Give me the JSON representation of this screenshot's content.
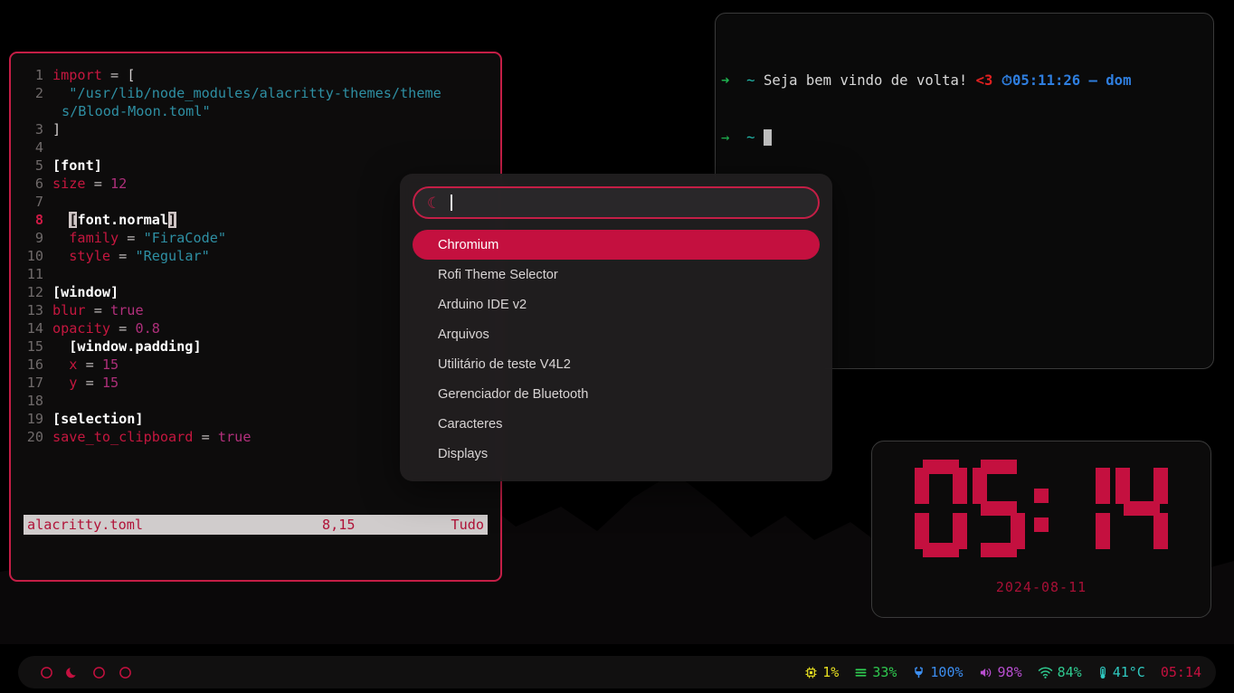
{
  "desktop": {
    "wallpaper_color": "#000000",
    "accent_color": "#c4103f"
  },
  "editor": {
    "window_name": "alacritty-editor",
    "border_color": "#c41e46",
    "lines": [
      {
        "n": "1",
        "current": false
      },
      {
        "n": "2",
        "current": false
      },
      {
        "n": "3",
        "current": false
      },
      {
        "n": "4",
        "current": false
      },
      {
        "n": "5",
        "current": false
      },
      {
        "n": "6",
        "current": false
      },
      {
        "n": "7",
        "current": false
      },
      {
        "n": "8",
        "current": true
      },
      {
        "n": "9",
        "current": false
      },
      {
        "n": "10",
        "current": false
      },
      {
        "n": "11",
        "current": false
      },
      {
        "n": "12",
        "current": false
      },
      {
        "n": "13",
        "current": false
      },
      {
        "n": "14",
        "current": false
      },
      {
        "n": "15",
        "current": false
      },
      {
        "n": "16",
        "current": false
      },
      {
        "n": "17",
        "current": false
      },
      {
        "n": "18",
        "current": false
      },
      {
        "n": "19",
        "current": false
      },
      {
        "n": "20",
        "current": false
      }
    ],
    "text": {
      "l1_key": "import",
      "l1_eq": " = ",
      "l1_brk": "[",
      "l2_str": "  \"/usr/lib/node_modules/alacritty-themes/theme",
      "l2_wrap": "s/Blood-Moon.toml\"",
      "l3": "]",
      "l5": "[font]",
      "l6_key": "size",
      "l6_eq": " = ",
      "l6_num": "12",
      "l8_open": "[",
      "l8_mid": "font.normal",
      "l8_close": "]",
      "l9_key": "  family",
      "l9_eq": " = ",
      "l9_str": "\"FiraCode\"",
      "l10_key": "  style",
      "l10_eq": " = ",
      "l10_str": "\"Regular\"",
      "l12": "[window]",
      "l13_key": "blur",
      "l13_eq": " = ",
      "l13_bool": "true",
      "l14_key": "opacity",
      "l14_eq": " = ",
      "l14_num": "0.8",
      "l15": "  [window.padding]",
      "l16_key": "  x",
      "l16_eq": " = ",
      "l16_num": "15",
      "l17_key": "  y",
      "l17_eq": " = ",
      "l17_num": "15",
      "l19": "[selection]",
      "l20_key": "save_to_clipboard",
      "l20_eq": " = ",
      "l20_bool": "true"
    },
    "status": {
      "filename": "alacritty.toml",
      "position": "8,15",
      "percent": "Tudo"
    }
  },
  "terminal": {
    "prompt_arrow_1": "➜",
    "prompt_arrow_2": "→",
    "tilde": "~",
    "greeting": "Seja bem vindo de volta!",
    "heart": "<3",
    "clock_icon": "⏱",
    "time": "05:11:26",
    "dash": "–",
    "day": "dom"
  },
  "rofi": {
    "icon": "moon-icon",
    "input_value": "",
    "input_placeholder": "",
    "items": [
      {
        "label": "Chromium",
        "selected": true
      },
      {
        "label": "Rofi Theme Selector",
        "selected": false
      },
      {
        "label": "Arduino IDE v2",
        "selected": false
      },
      {
        "label": "Arquivos",
        "selected": false
      },
      {
        "label": "Utilitário de teste V4L2",
        "selected": false
      },
      {
        "label": "Gerenciador de Bluetooth",
        "selected": false
      },
      {
        "label": "Caracteres",
        "selected": false
      },
      {
        "label": "Displays",
        "selected": false
      }
    ]
  },
  "clock_widget": {
    "hours": "05",
    "minutes": "14",
    "time": "05:14",
    "date": "2024-08-11",
    "color": "#c4103f"
  },
  "statusbar": {
    "workspaces": [
      {
        "name": "workspace-1",
        "icon": "circle-icon",
        "active": false
      },
      {
        "name": "workspace-2",
        "icon": "moon-icon",
        "active": true
      },
      {
        "name": "workspace-3",
        "icon": "circle-icon",
        "active": false
      },
      {
        "name": "workspace-4",
        "icon": "circle-icon",
        "active": false
      }
    ],
    "modules": [
      {
        "name": "cpu",
        "icon": "cpu-chip-icon",
        "value": "1%",
        "color": "#e8e020"
      },
      {
        "name": "memory",
        "icon": "memory-bars-icon",
        "value": "33%",
        "color": "#2fc94f"
      },
      {
        "name": "battery",
        "icon": "plug-icon",
        "value": "100%",
        "color": "#3c8ef0"
      },
      {
        "name": "volume",
        "icon": "speaker-icon",
        "value": "98%",
        "color": "#b84ed0"
      },
      {
        "name": "network",
        "icon": "wifi-icon",
        "value": "84%",
        "color": "#2fc98f"
      },
      {
        "name": "temperature",
        "icon": "thermometer-icon",
        "value": "41°C",
        "color": "#2fc9c0"
      },
      {
        "name": "clock",
        "icon": "",
        "value": "05:14",
        "color": "#c4103f"
      }
    ]
  }
}
